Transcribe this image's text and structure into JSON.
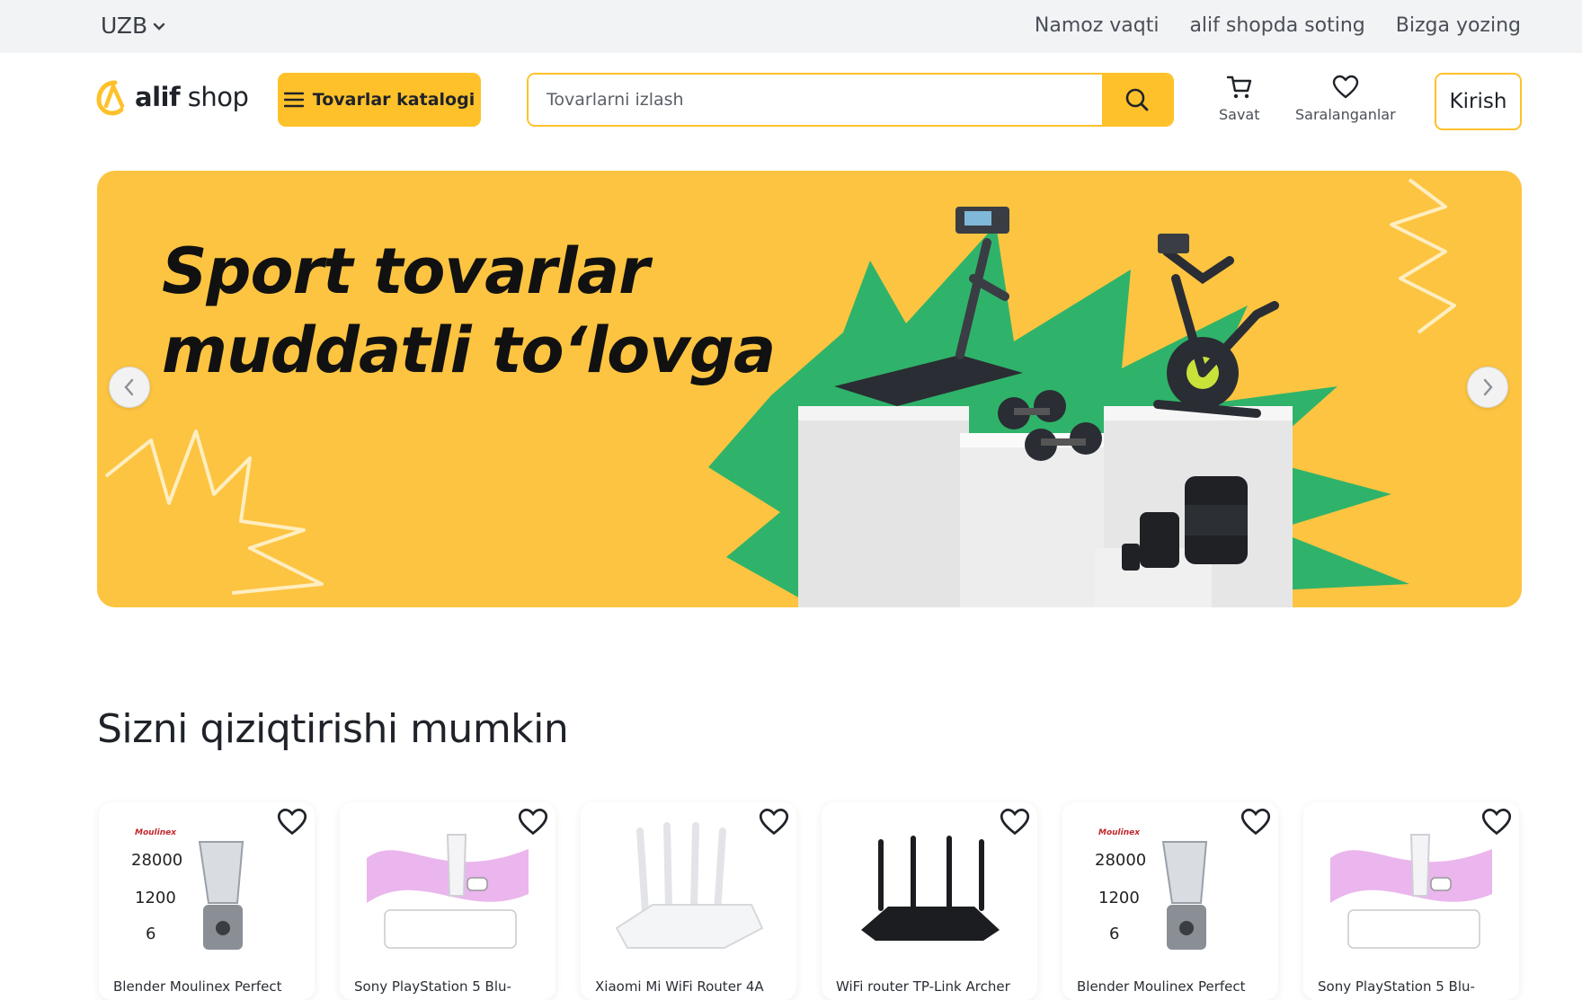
{
  "topbar": {
    "language": "UZB",
    "links": [
      "Namoz vaqti",
      "alif shopda soting",
      "Bizga yozing"
    ]
  },
  "header": {
    "logo_bold": "alif",
    "logo_light": "shop",
    "catalog_label": "Tovarlar katalogi",
    "search_placeholder": "Tovarlarni izlash",
    "cart_label": "Savat",
    "favorites_label": "Saralanganlar",
    "login_label": "Kirish"
  },
  "banner": {
    "line1": "Sport tovarlar",
    "line2": "muddatli to‘lovga",
    "brand_color": "#fdc441",
    "accent_green": "#2fb36a"
  },
  "section": {
    "title": "Sizni qiziqtirishi mumkin"
  },
  "products": [
    {
      "name": "Blender Moulinex Perfect",
      "image": "blender-image",
      "card_text": [
        "28000",
        "1200",
        "6"
      ]
    },
    {
      "name": "Sony PlayStation 5 Blu-",
      "image": "playstation-image"
    },
    {
      "name": "Xiaomi Mi WiFi Router 4A",
      "image": "router-white-image"
    },
    {
      "name": "WiFi router TP-Link Archer",
      "image": "router-black-image"
    },
    {
      "name": "Blender Moulinex Perfect",
      "image": "blender-image",
      "card_text": [
        "28000",
        "1200",
        "6"
      ]
    },
    {
      "name": "Sony PlayStation 5 Blu-",
      "image": "playstation-image"
    }
  ],
  "colors": {
    "accent": "#fec12a",
    "topbar_bg": "#f2f3f5"
  }
}
